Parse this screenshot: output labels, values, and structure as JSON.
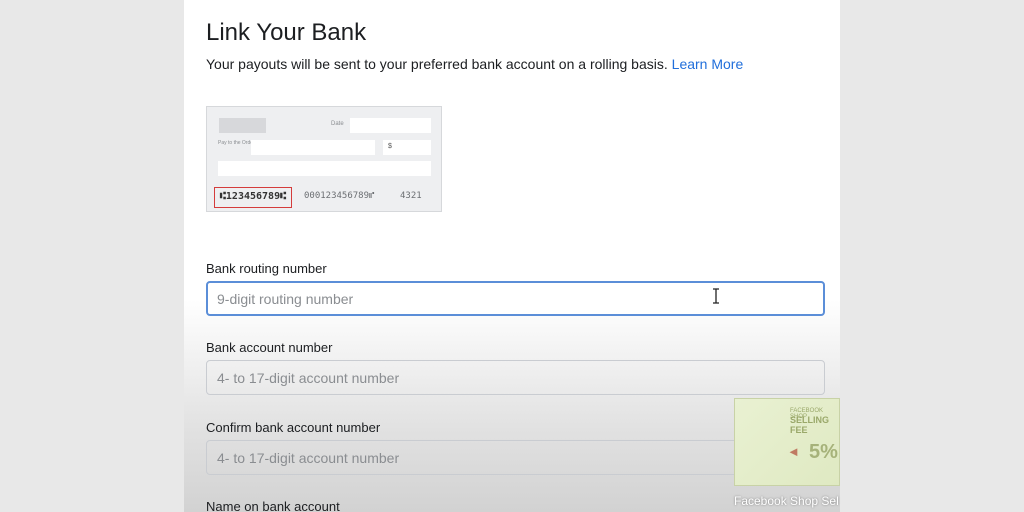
{
  "header": {
    "title": "Link Your Bank",
    "subtitle": "Your payouts will be sent to your preferred bank account on a rolling basis.",
    "learn_more": "Learn More"
  },
  "check": {
    "date_label": "Date",
    "pay_to_label": "Pay to the Order of:",
    "dollar": "$",
    "routing": "⑆123456789⑆",
    "account": "000123456789⑈",
    "check_number": "4321"
  },
  "form": {
    "routing": {
      "label": "Bank routing number",
      "placeholder": "9-digit routing number",
      "value": ""
    },
    "account": {
      "label": "Bank account number",
      "placeholder": "4- to 17-digit account number",
      "value": ""
    },
    "confirm": {
      "label": "Confirm bank account number",
      "placeholder": "4- to 17-digit account number",
      "value": ""
    },
    "name": {
      "label": "Name on bank account"
    }
  },
  "thumbnail": {
    "top_text": "FACEBOOK SHOP",
    "headline": "SELLING FEE",
    "percent": "5%",
    "caption": "Facebook Shop Sel"
  }
}
